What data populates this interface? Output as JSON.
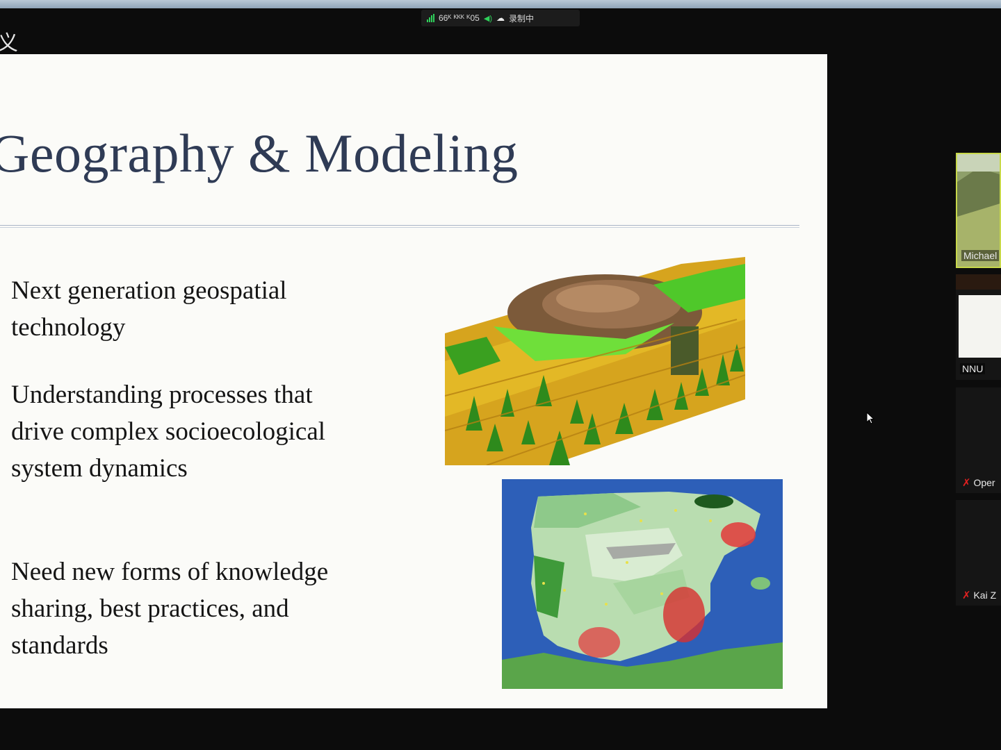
{
  "status_bar": {
    "network": "66ᴷ ᴷᴷᴷ ᴷ05",
    "recording": "录制中"
  },
  "window": {
    "close_glyph": "义"
  },
  "slide": {
    "title": "Geography & Modeling",
    "bullets": [
      "Next generation geospatial technology",
      "Understanding processes that drive complex socioecological system dynamics",
      "Need new forms of knowledge sharing, best practices, and standards"
    ],
    "images": [
      "3d-lidar-terrain-model",
      "iberian-peninsula-land-cover-map"
    ]
  },
  "participants": [
    {
      "name": "Michael",
      "muted": false
    },
    {
      "name": "NNU",
      "muted": false
    },
    {
      "name": "Oper",
      "muted": true
    },
    {
      "name": "Kai Z",
      "muted": true
    }
  ],
  "colors": {
    "slide_bg": "#fbfbf8",
    "title": "#2f3b55",
    "app_bg": "#0c0c0c",
    "muted_icon": "#e02020",
    "active_speaker_border": "#c8d94a"
  }
}
